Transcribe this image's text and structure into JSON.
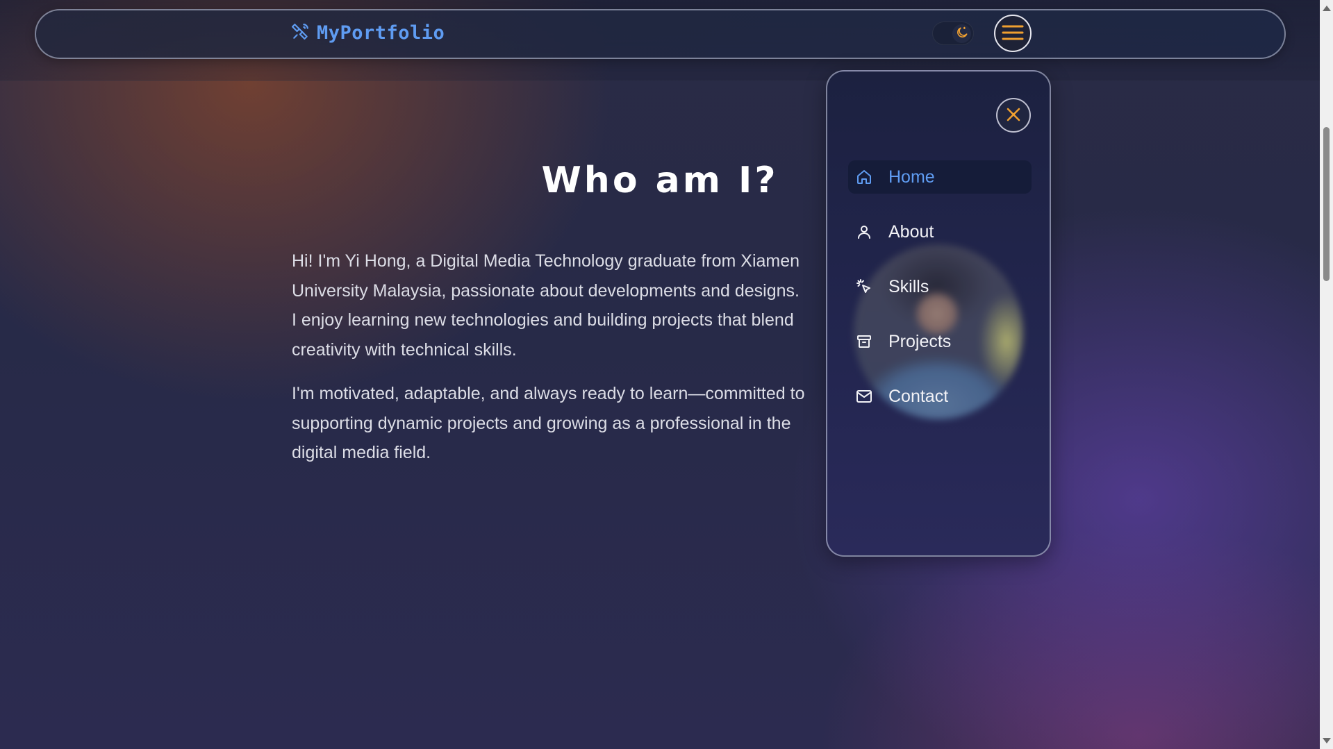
{
  "brand": {
    "name": "MyPortfolio",
    "icon": "satellite-icon",
    "color": "#5f9cf2"
  },
  "theme_toggle": {
    "icon": "moon-icon",
    "accent": "#f0a030"
  },
  "menu_button": {
    "icon": "hamburger-icon",
    "accent": "#f0a030"
  },
  "about": {
    "heading": "Who am I?",
    "paragraphs": [
      "Hi! I'm Yi Hong, a Digital Media Technology graduate from Xiamen University Malaysia, passionate about developments and designs. I enjoy learning new technologies and building projects that blend creativity with technical skills.",
      "I'm motivated, adaptable, and always ready to learn—committed to supporting dynamic projects and growing as a professional in the digital media field."
    ]
  },
  "menu_panel": {
    "close_icon": "close-icon",
    "items": [
      {
        "label": "Home",
        "icon": "home-icon",
        "active": true
      },
      {
        "label": "About",
        "icon": "user-icon",
        "active": false
      },
      {
        "label": "Skills",
        "icon": "sparkle-cursor-icon",
        "active": false
      },
      {
        "label": "Projects",
        "icon": "archive-icon",
        "active": false
      },
      {
        "label": "Contact",
        "icon": "mail-icon",
        "active": false
      }
    ]
  },
  "colors": {
    "active_link": "#5f9cf2",
    "accent": "#f0a030",
    "text": "#dcdde6"
  }
}
